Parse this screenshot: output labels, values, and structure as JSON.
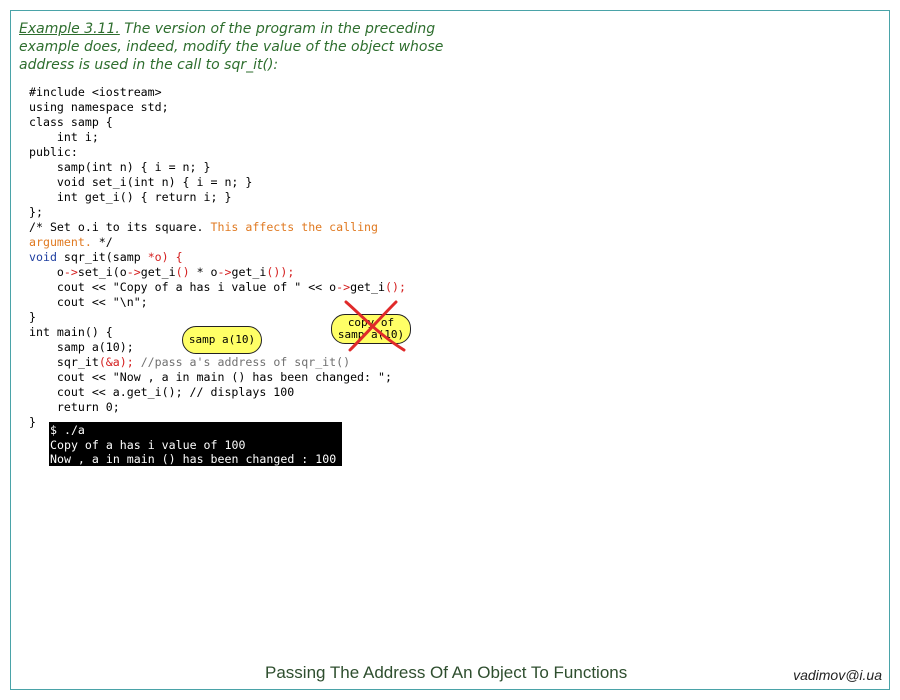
{
  "intro": {
    "example_label": "Example 3.11.",
    "text": " The version of the program in the preceding example does, indeed, modify the value of the object whose address is used in the call to sqr_it():"
  },
  "code": {
    "l01": "#include <iostream>",
    "l02": "using namespace std;",
    "l03": "class samp {",
    "l04": "    int i;",
    "l05": "public:",
    "l06": "    samp(int n) { i = n; }",
    "l07": "    void set_i(int n) { i = n; }",
    "l08": "    int get_i() { return i; }",
    "l09": "};",
    "l10a": "/* Set o.i to its square. ",
    "l10b": "This affects the calling",
    "l11a": "argument.",
    "l11b": " */",
    "l12a": "void",
    "l12b": " sqr_it",
    "l12c": "(samp ",
    "l12d": "*o",
    "l12e": ") {",
    "l13a": "    o",
    "l13b": "->",
    "l13c": "set_i(o",
    "l13d": "->",
    "l13e": "get_i",
    "l13f": "()",
    "l13g": " * o",
    "l13h": "->",
    "l13i": "get_i",
    "l13j": "());",
    "l14a": "    cout << \"Copy of a has i value of \" << o",
    "l14b": "->",
    "l14c": "get_i",
    "l14d": "();",
    "l15": "    cout << \"\\n\";",
    "l16": "}",
    "l17": "int main() {",
    "l18": "    samp a(10);",
    "l19a": "    sqr_it",
    "l19b": "(&a);",
    "l19c": " //pass a's address of sqr_it()",
    "l20": "    cout << \"Now , a in main () has been changed: \";",
    "l21": "    cout << a.get_i(); // displays 100",
    "l22": "    return 0;",
    "l23": "}"
  },
  "bubbles": {
    "object_a": "samp a(10)",
    "copy_line1": "copy of",
    "copy_line2": "samp a(10)"
  },
  "terminal": {
    "line1": "$ ./a",
    "line2": "Copy of a has i value of 100",
    "line3": "Now , a in main () has been changed : 100"
  },
  "footer": {
    "title": "Passing The Address Of An Object To Functions",
    "email": "vadimov@i.ua"
  }
}
